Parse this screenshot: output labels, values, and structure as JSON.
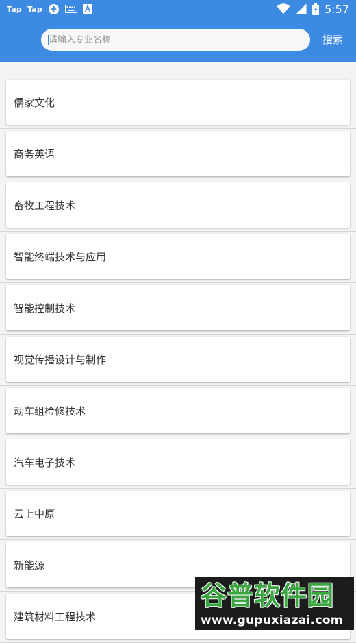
{
  "status_bar": {
    "apps": [
      "Tap",
      "Tap"
    ],
    "time": "5:57",
    "icons": [
      "sync-icon",
      "keyboard-icon",
      "a-notification-icon",
      "wifi-icon",
      "cell-signal-icon",
      "battery-icon"
    ]
  },
  "search": {
    "placeholder": "请输入专业名称",
    "value": "",
    "button_label": "搜索"
  },
  "majors": [
    "儒家文化",
    "商务英语",
    "畜牧工程技术",
    "智能终端技术与应用",
    "智能控制技术",
    "视觉传播设计与制作",
    "动车组检修技术",
    "汽车电子技术",
    "云上中原",
    "新能源",
    "建筑材料工程技术"
  ],
  "watermark": {
    "title": "谷普软件园",
    "url": "www.gupuxiazai.com"
  },
  "colors": {
    "accent": "#3d8ae3",
    "background": "#f4f4f4",
    "card": "#ffffff",
    "text": "#333333",
    "placeholder": "#8f8f8f",
    "watermark_green": "#3aa640"
  }
}
